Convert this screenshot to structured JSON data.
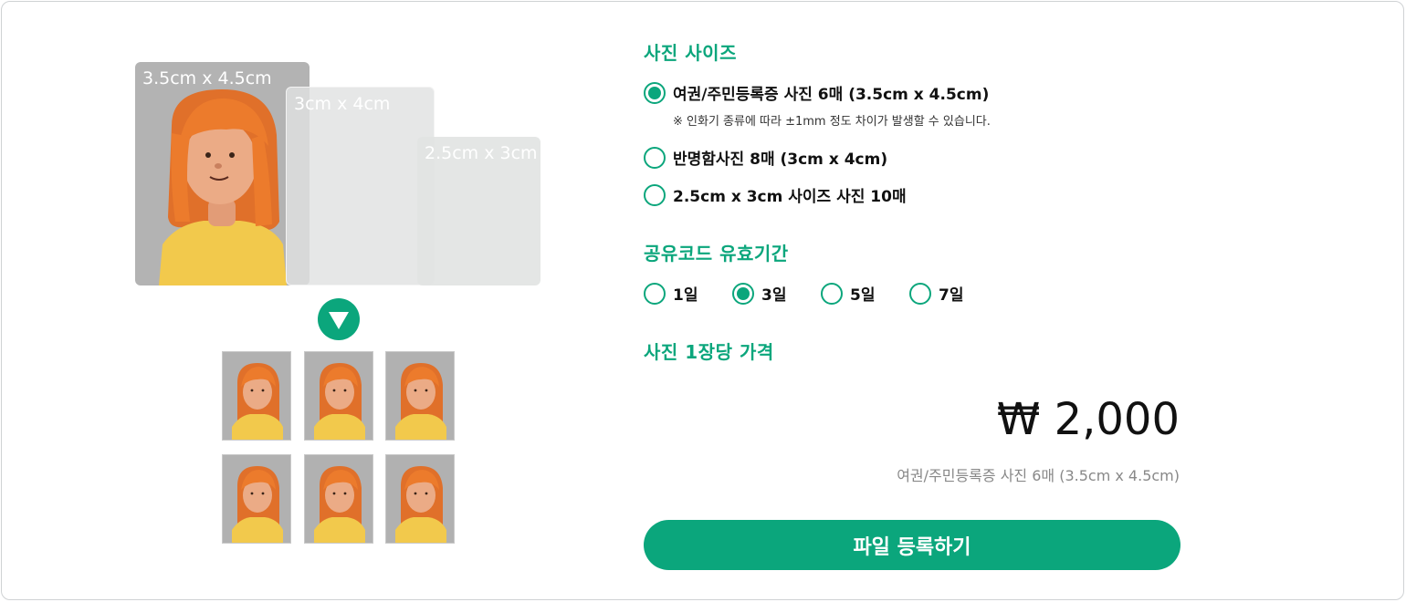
{
  "illustration": {
    "sizes": [
      {
        "label": "3.5cm x 4.5cm"
      },
      {
        "label": "3cm x 4cm"
      },
      {
        "label": "2.5cm x 3cm"
      }
    ],
    "arrow_icon": "triangle-down-icon",
    "thumbnail_count": 6
  },
  "photo_size": {
    "title": "사진 사이즈",
    "options": [
      {
        "label": "여권/주민등록증 사진 6매 (3.5cm x 4.5cm)",
        "checked": true
      },
      {
        "label": "반명함사진 8매 (3cm x 4cm)",
        "checked": false
      },
      {
        "label": "2.5cm x 3cm 사이즈 사진 10매",
        "checked": false
      }
    ],
    "note": "※ 인화기 종류에 따라 ±1mm 정도 차이가 발생할 수 있습니다."
  },
  "share_code": {
    "title": "공유코드 유효기간",
    "options": [
      {
        "label": "1일",
        "checked": false
      },
      {
        "label": "3일",
        "checked": true
      },
      {
        "label": "5일",
        "checked": false
      },
      {
        "label": "7일",
        "checked": false
      }
    ]
  },
  "pricing": {
    "title": "사진 1장당 가격",
    "price": "₩ 2,000",
    "description": "여권/주민등록증 사진 6매 (3.5cm x 4.5cm)"
  },
  "actions": {
    "submit_label": "파일 등록하기"
  },
  "colors": {
    "accent": "#0ba67c",
    "photo_bg": "#b3b3b3",
    "hair": "#e8782a",
    "shirt": "#f2c94c",
    "skin": "#e9a27d"
  }
}
